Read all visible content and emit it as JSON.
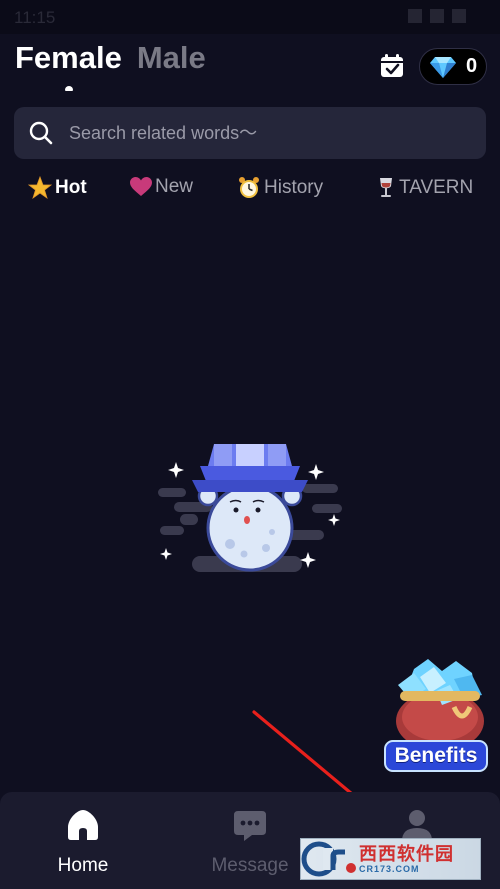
{
  "status_bar": {
    "time": "11:15"
  },
  "header": {
    "tabs": [
      {
        "label": "Female",
        "active": true
      },
      {
        "label": "Male",
        "active": false
      }
    ],
    "gem_count": "0"
  },
  "search": {
    "placeholder": "Search related words～"
  },
  "categories": [
    {
      "label": "Hot",
      "icon": "star-icon",
      "active": true
    },
    {
      "label": "New",
      "icon": "heart-icon",
      "active": false
    },
    {
      "label": "History",
      "icon": "alarm-clock-icon",
      "active": false
    },
    {
      "label": "TAVERN",
      "icon": "wine-glass-icon",
      "active": false
    }
  ],
  "empty_state": {
    "illustration": "ghost-moon-icon"
  },
  "benefits": {
    "label": "Benefits"
  },
  "bottom_nav": [
    {
      "label": "Home",
      "icon": "home-icon",
      "active": true
    },
    {
      "label": "Message",
      "icon": "message-icon",
      "active": false
    },
    {
      "label": "",
      "icon": "profile-icon",
      "active": false
    }
  ],
  "watermark": {
    "cn": "西西软件园",
    "en": "CR173.COM",
    "logo_text": "Cr"
  },
  "colors": {
    "background": "#0f0f20",
    "search_bg": "#25263a",
    "nav_bg": "#1b1b2e",
    "accent_star": "#f5b82e",
    "accent_heart": "#c83a7a",
    "benefits_blue": "#2b47d8",
    "annotation_red": "#e8201c"
  }
}
